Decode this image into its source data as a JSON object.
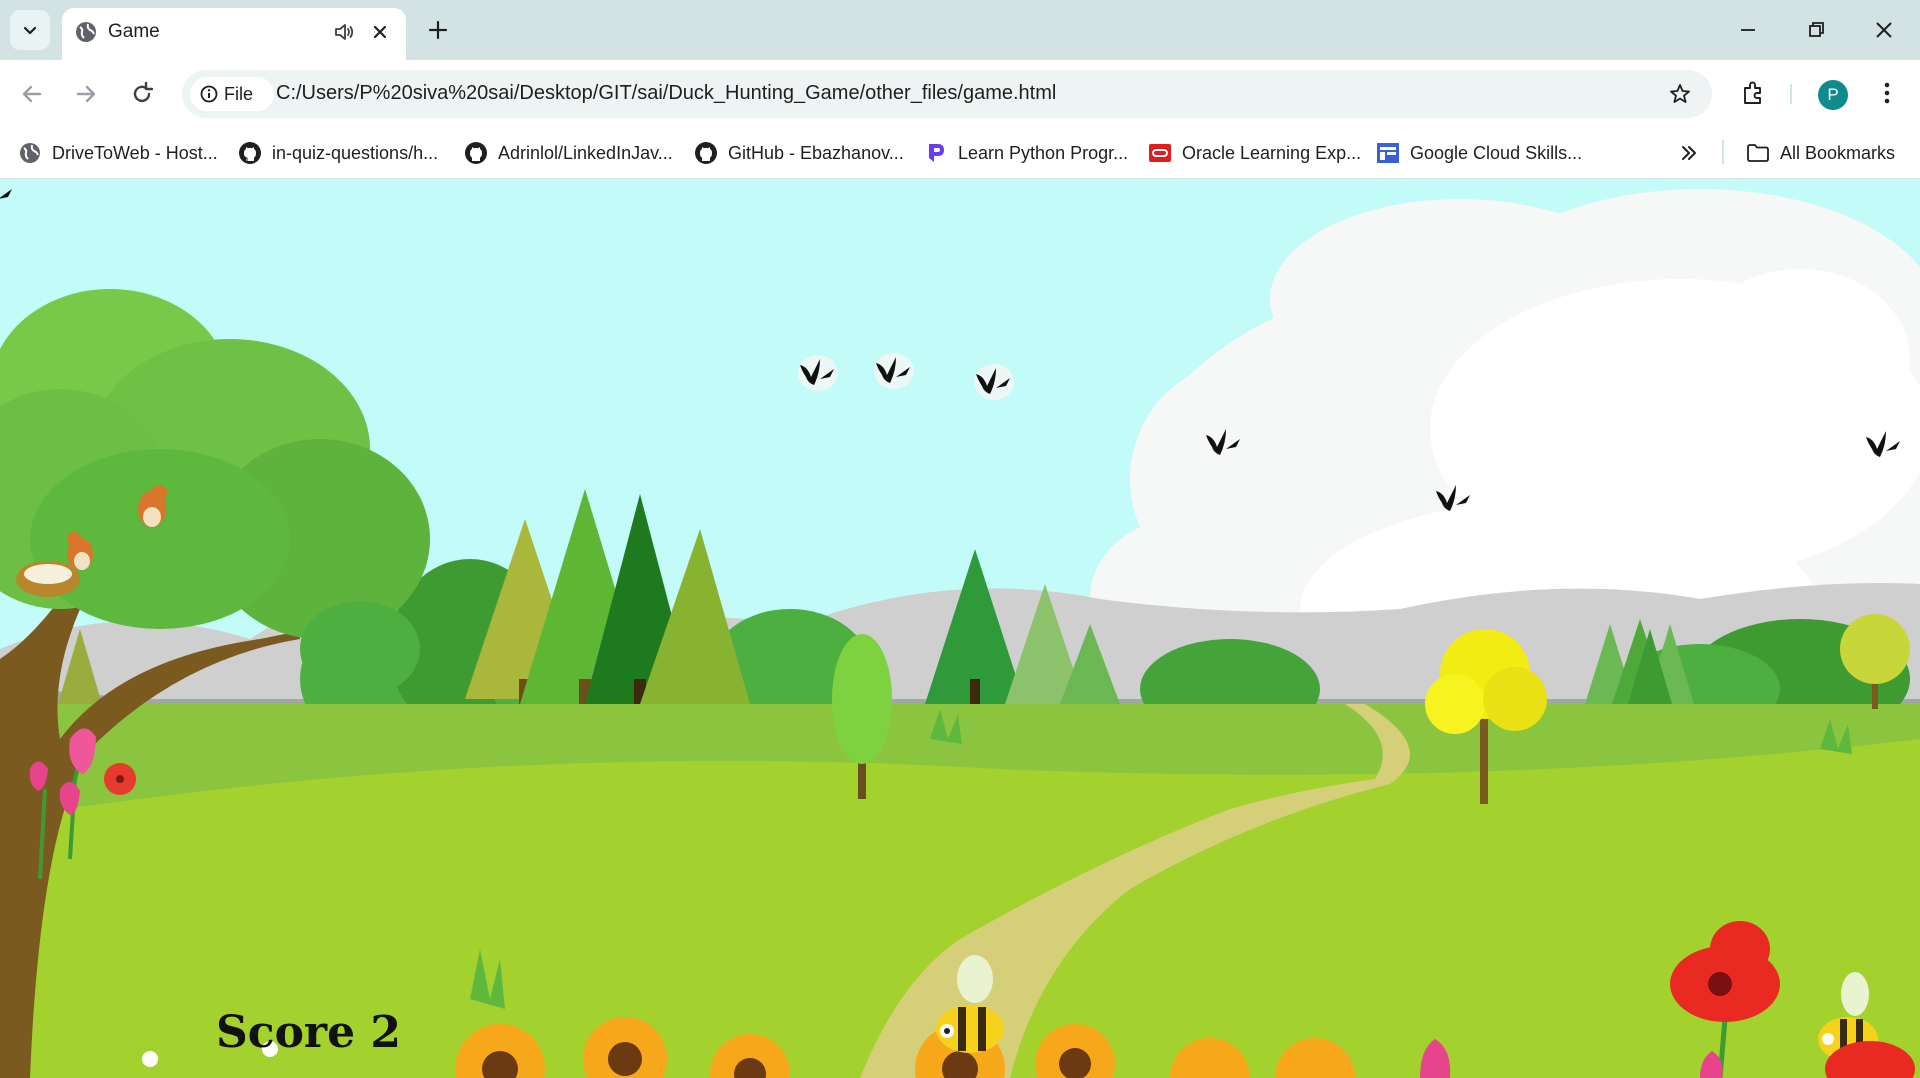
{
  "browser": {
    "tab_title": "Game",
    "site_chip_label": "File",
    "url": "C:/Users/P%20siva%20sai/Desktop/GIT/sai/Duck_Hunting_Game/other_files/game.html",
    "profile_initial": "P",
    "accent_color": "#0f8b8d"
  },
  "bookmarks": {
    "items": [
      {
        "label": "DriveToWeb - Host...",
        "icon": "globe-icon"
      },
      {
        "label": "in-quiz-questions/h...",
        "icon": "github-icon"
      },
      {
        "label": "Adrinlol/LinkedInJav...",
        "icon": "github-icon"
      },
      {
        "label": "GitHub - Ebazhanov...",
        "icon": "github-icon"
      },
      {
        "label": "Learn Python Progr...",
        "icon": "programiz-icon"
      },
      {
        "label": "Oracle Learning Exp...",
        "icon": "oracle-icon"
      },
      {
        "label": "Google Cloud Skills...",
        "icon": "google-cloud-skills-icon"
      }
    ],
    "all_bookmarks_label": "All Bookmarks"
  },
  "game": {
    "score_text": "Score 2",
    "duck_count": 7
  }
}
